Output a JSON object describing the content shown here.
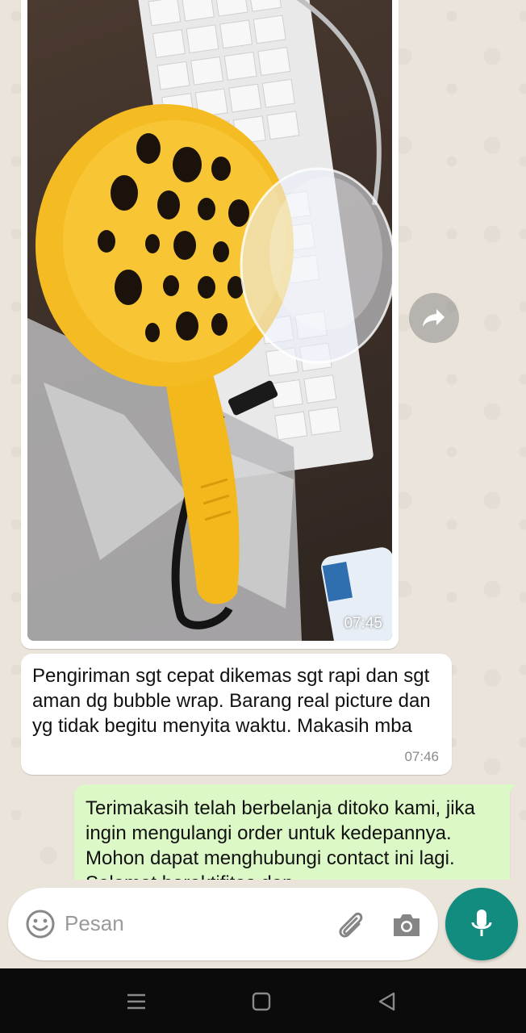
{
  "messages": {
    "image": {
      "time": "07:45"
    },
    "received": {
      "text": "Pengiriman sgt cepat dikemas sgt rapi dan sgt aman dg bubble wrap. Barang real picture dan yg tidak begitu menyita waktu. Makasih mba",
      "time": "07:46"
    },
    "sent": {
      "text": "Terimakasih telah berbelanja ditoko kami, jika ingin mengulangi order untuk kedepannya. Mohon dapat menghubungi contact ini lagi. Selamat beraktifitas dan"
    }
  },
  "composer": {
    "placeholder": "Pesan"
  },
  "colors": {
    "accent": "#128c7e",
    "outgoing_bubble": "#dcf8c6",
    "incoming_bubble": "#ffffff"
  },
  "icons": [
    "forward-icon",
    "emoji-icon",
    "attach-icon",
    "camera-icon",
    "mic-icon",
    "nav-menu-icon",
    "nav-home-icon",
    "nav-back-icon"
  ]
}
